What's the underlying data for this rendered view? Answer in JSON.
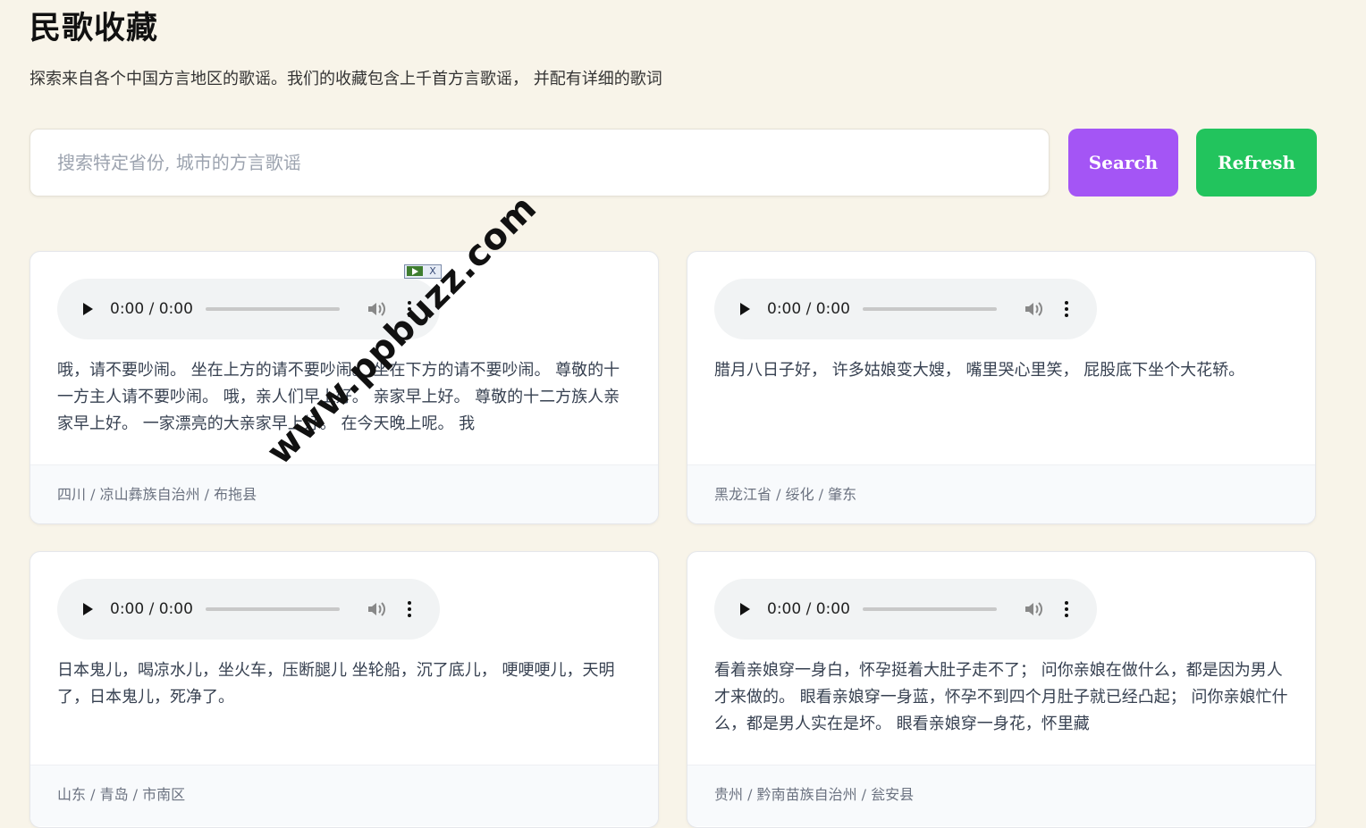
{
  "page": {
    "title": "民歌收藏",
    "description": "探索来自各个中国方言地区的歌谣。我们的收藏包含上千首方言歌谣， 并配有详细的歌词"
  },
  "search": {
    "placeholder": "搜索特定省份, 城市的方言歌谣",
    "value": "",
    "search_label": "Search",
    "refresh_label": "Refresh"
  },
  "colors": {
    "background": "#f8f4e9",
    "search_button": "#a455f5",
    "refresh_button": "#22c45d"
  },
  "songs": [
    {
      "player_time": "0:00 / 0:00",
      "lyrics": "哦，请不要吵闹。 坐在上方的请不要吵闹。 坐在下方的请不要吵闹。 尊敬的十一方主人请不要吵闹。 哦，亲人们早上好。 亲家早上好。 尊敬的十二方族人亲家早上好。 一家漂亮的大亲家早上好。 在今天晚上呢。 我",
      "location": "四川 / 凉山彝族自治州 / 布拖县"
    },
    {
      "player_time": "0:00 / 0:00",
      "lyrics": "腊月八日子好， 许多姑娘变大嫂， 嘴里哭心里笑， 屁股底下坐个大花轿。",
      "location": "黑龙江省 / 绥化 / 肇东"
    },
    {
      "player_time": "0:00 / 0:00",
      "lyrics": "日本鬼儿，喝凉水儿，坐火车，压断腿儿 坐轮船，沉了底儿， 哽哽哽儿，天明了，日本鬼儿，死净了。",
      "location": "山东 / 青岛 / 市南区"
    },
    {
      "player_time": "0:00 / 0:00",
      "lyrics": "看着亲娘穿一身白，怀孕挺着大肚子走不了； 问你亲娘在做什么，都是因为男人才来做的。 眼看亲娘穿一身蓝，怀孕不到四个月肚子就已经凸起； 问你亲娘忙什么，都是男人实在是坏。 眼看亲娘穿一身花，怀里藏",
      "location": "贵州 / 黔南苗族自治州 / 瓮安县"
    }
  ],
  "overlay": {
    "watermark_text": "www.ppbuzz.com",
    "ad_close_label": "X"
  },
  "icons": [
    "play-icon",
    "volume-icon",
    "more-options-icon",
    "ad-play-icon",
    "ad-close-icon"
  ]
}
